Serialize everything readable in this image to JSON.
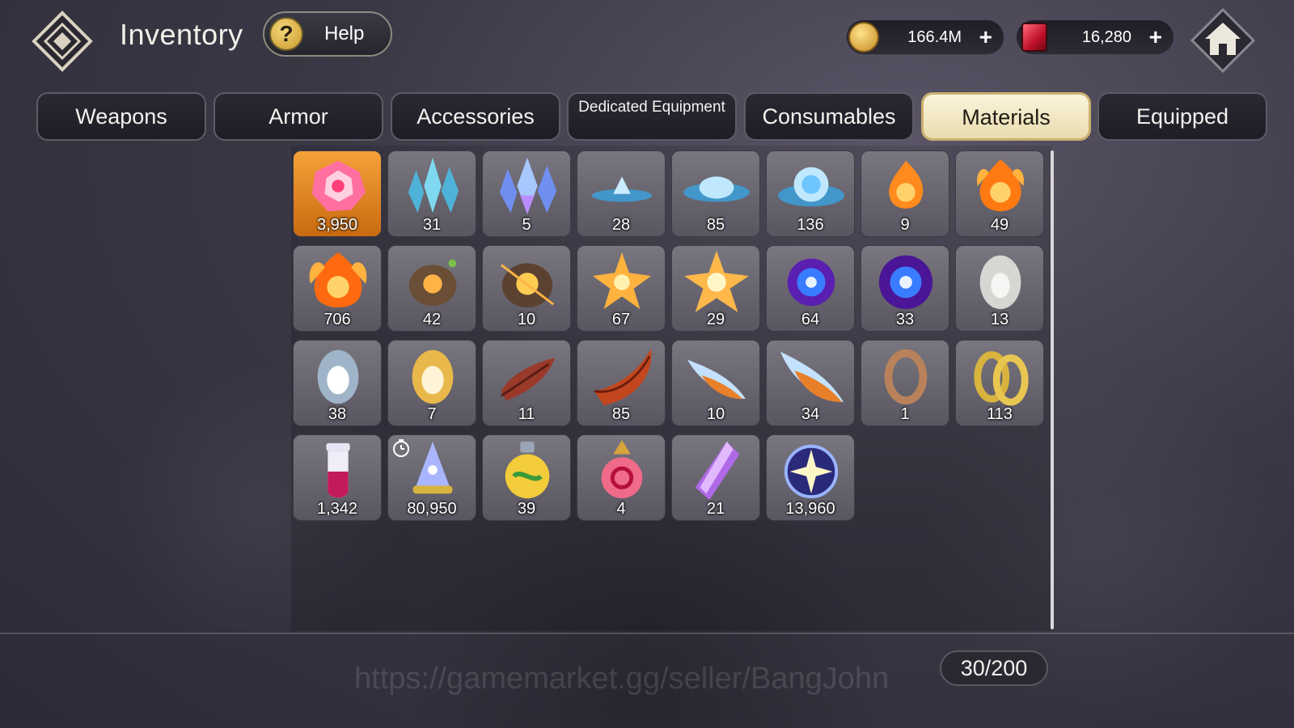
{
  "header": {
    "title": "Inventory",
    "help_label": "Help",
    "help_icon_glyph": "?",
    "gold": "166.4M",
    "gems": "16,280",
    "plus_glyph": "+"
  },
  "tabs": [
    {
      "label": "Weapons",
      "active": false
    },
    {
      "label": "Armor",
      "active": false
    },
    {
      "label": "Accessories",
      "active": false
    },
    {
      "label": "Dedicated Equipment",
      "active": false
    },
    {
      "label": "Consumables",
      "active": false
    },
    {
      "label": "Materials",
      "active": true
    },
    {
      "label": "Equipped",
      "active": false
    }
  ],
  "items": [
    {
      "name": "rainbow-rose-crystal-icon",
      "qty": "3,950",
      "selected": true
    },
    {
      "name": "teal-crystal-cluster-icon",
      "qty": "31"
    },
    {
      "name": "blue-crystal-cluster-icon",
      "qty": "5"
    },
    {
      "name": "small-water-droplet-icon",
      "qty": "28"
    },
    {
      "name": "medium-water-orb-icon",
      "qty": "85"
    },
    {
      "name": "large-water-orb-icon",
      "qty": "136"
    },
    {
      "name": "small-fire-essence-icon",
      "qty": "9"
    },
    {
      "name": "medium-fire-essence-icon",
      "qty": "49"
    },
    {
      "name": "large-fire-essence-icon",
      "qty": "706"
    },
    {
      "name": "earth-ore-icon",
      "qty": "42"
    },
    {
      "name": "glowing-earth-ore-icon",
      "qty": "10"
    },
    {
      "name": "light-star-icon",
      "qty": "67"
    },
    {
      "name": "radiant-star-icon",
      "qty": "29"
    },
    {
      "name": "dark-vortex-icon",
      "qty": "64"
    },
    {
      "name": "large-dark-vortex-icon",
      "qty": "33"
    },
    {
      "name": "silver-egg-icon",
      "qty": "13"
    },
    {
      "name": "white-egg-icon",
      "qty": "38"
    },
    {
      "name": "golden-egg-icon",
      "qty": "7"
    },
    {
      "name": "red-feather-icon",
      "qty": "11"
    },
    {
      "name": "red-horn-icon",
      "qty": "85"
    },
    {
      "name": "fire-wing-icon",
      "qty": "10"
    },
    {
      "name": "large-fire-wing-icon",
      "qty": "34"
    },
    {
      "name": "bronze-ring-icon",
      "qty": "1"
    },
    {
      "name": "gold-rings-icon",
      "qty": "113"
    },
    {
      "name": "red-potion-vial-icon",
      "qty": "1,342"
    },
    {
      "name": "star-sand-hourglass-icon",
      "qty": "80,950",
      "timer": true
    },
    {
      "name": "green-potion-flask-icon",
      "qty": "39"
    },
    {
      "name": "red-potion-flask-icon",
      "qty": "4"
    },
    {
      "name": "purple-crystal-shard-icon",
      "qty": "21"
    },
    {
      "name": "starlight-orb-icon",
      "qty": "13,960"
    }
  ],
  "footer": {
    "watermark": "https://gamemarket.gg/seller/BangJohn",
    "capacity": "30/200"
  },
  "colors": {
    "active_tab": "#f6eccb",
    "selected_slot": "#e58a22",
    "slot": "#6a6772"
  }
}
